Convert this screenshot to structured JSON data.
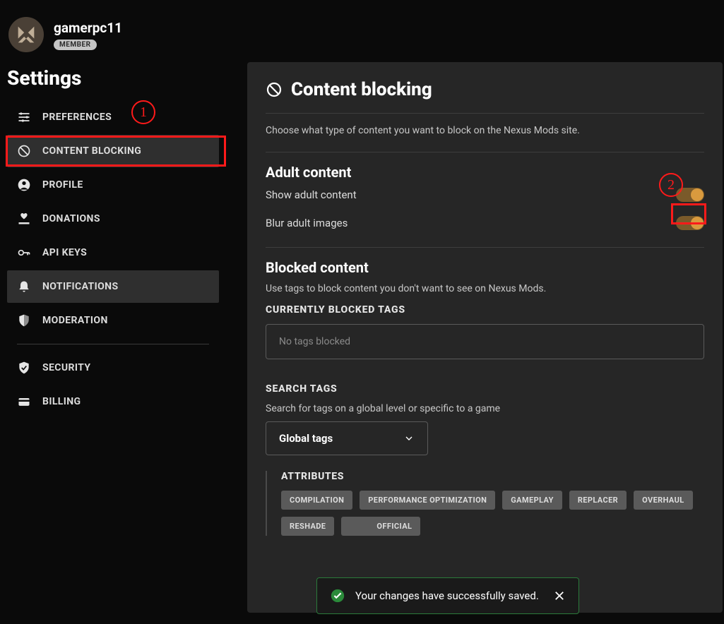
{
  "user": {
    "name": "gamerpc11",
    "badge": "MEMBER"
  },
  "sidebar": {
    "title": "Settings",
    "items": [
      {
        "label": "PREFERENCES"
      },
      {
        "label": "CONTENT BLOCKING"
      },
      {
        "label": "PROFILE"
      },
      {
        "label": "DONATIONS"
      },
      {
        "label": "API KEYS"
      },
      {
        "label": "NOTIFICATIONS"
      },
      {
        "label": "MODERATION"
      },
      {
        "label": "SECURITY"
      },
      {
        "label": "BILLING"
      }
    ]
  },
  "main": {
    "title": "Content blocking",
    "desc": "Choose what type of content you want to block on the Nexus Mods site.",
    "adult": {
      "title": "Adult content",
      "show": {
        "label": "Show adult content",
        "value": true
      },
      "blur": {
        "label": "Blur adult images",
        "value": true
      }
    },
    "blocked": {
      "title": "Blocked content",
      "desc": "Use tags to block content you don't want to see on Nexus Mods.",
      "current_label": "CURRENTLY BLOCKED TAGS",
      "placeholder": "No tags blocked"
    },
    "search": {
      "title": "SEARCH TAGS",
      "desc": "Search for tags on a global level or specific to a game",
      "select": "Global tags"
    },
    "attributes": {
      "title": "ATTRIBUTES",
      "tags": [
        "COMPILATION",
        "PERFORMANCE OPTIMIZATION",
        "GAMEPLAY",
        "REPLACER",
        "OVERHAUL",
        "RESHADE",
        "OFFICIAL"
      ]
    }
  },
  "annotations": {
    "one": "1",
    "two": "2"
  },
  "toast": {
    "text": "Your changes have successfully saved."
  }
}
